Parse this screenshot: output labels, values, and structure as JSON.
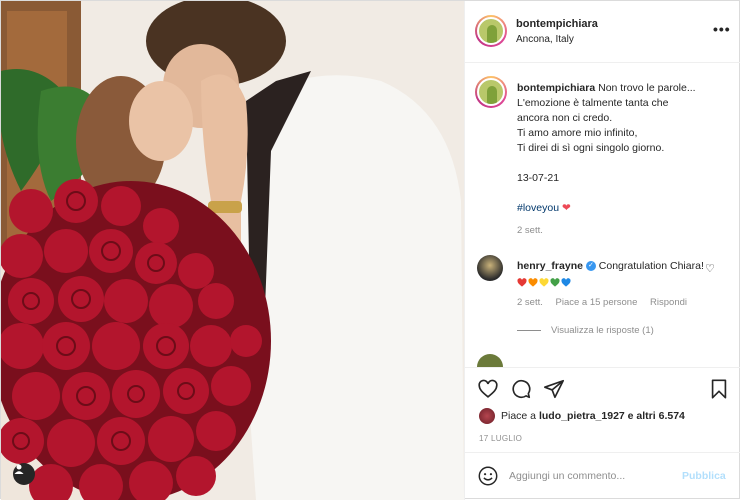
{
  "header": {
    "username": "bontempichiara",
    "location": "Ancona, Italy",
    "more_label": "•••"
  },
  "caption": {
    "username": "bontempichiara",
    "lines": [
      "Non trovo le parole...",
      "L'emozione è talmente tanta che",
      "ancora non ci credo.",
      "Ti amo amore mio infinito,",
      "Ti direi di sì ogni singolo giorno.",
      "",
      "13-07-21",
      "",
      "#loveyou"
    ],
    "time_ago": "2 sett."
  },
  "comment": {
    "username": "henry_frayne",
    "text": "Congratulation Chiara!",
    "time": "2 sett.",
    "likes": "Piace a 15 persone",
    "reply": "Rispondi",
    "view_replies": "Visualizza le risposte (1)"
  },
  "emoji_hearts": [
    "#e53935",
    "#fb8c00",
    "#fdd835",
    "#43a047",
    "#1e88e5"
  ],
  "likes": {
    "prefix": "Piace a",
    "user": "ludo_pietra_1927",
    "suffix": "e altri 6.574"
  },
  "date": "17 LUGLIO",
  "composer": {
    "placeholder": "Aggiungi un commento...",
    "publish": "Pubblica"
  },
  "colors": {
    "link": "#00376b",
    "muted": "#8e8e8e",
    "publish_disabled": "#b2dffc"
  }
}
